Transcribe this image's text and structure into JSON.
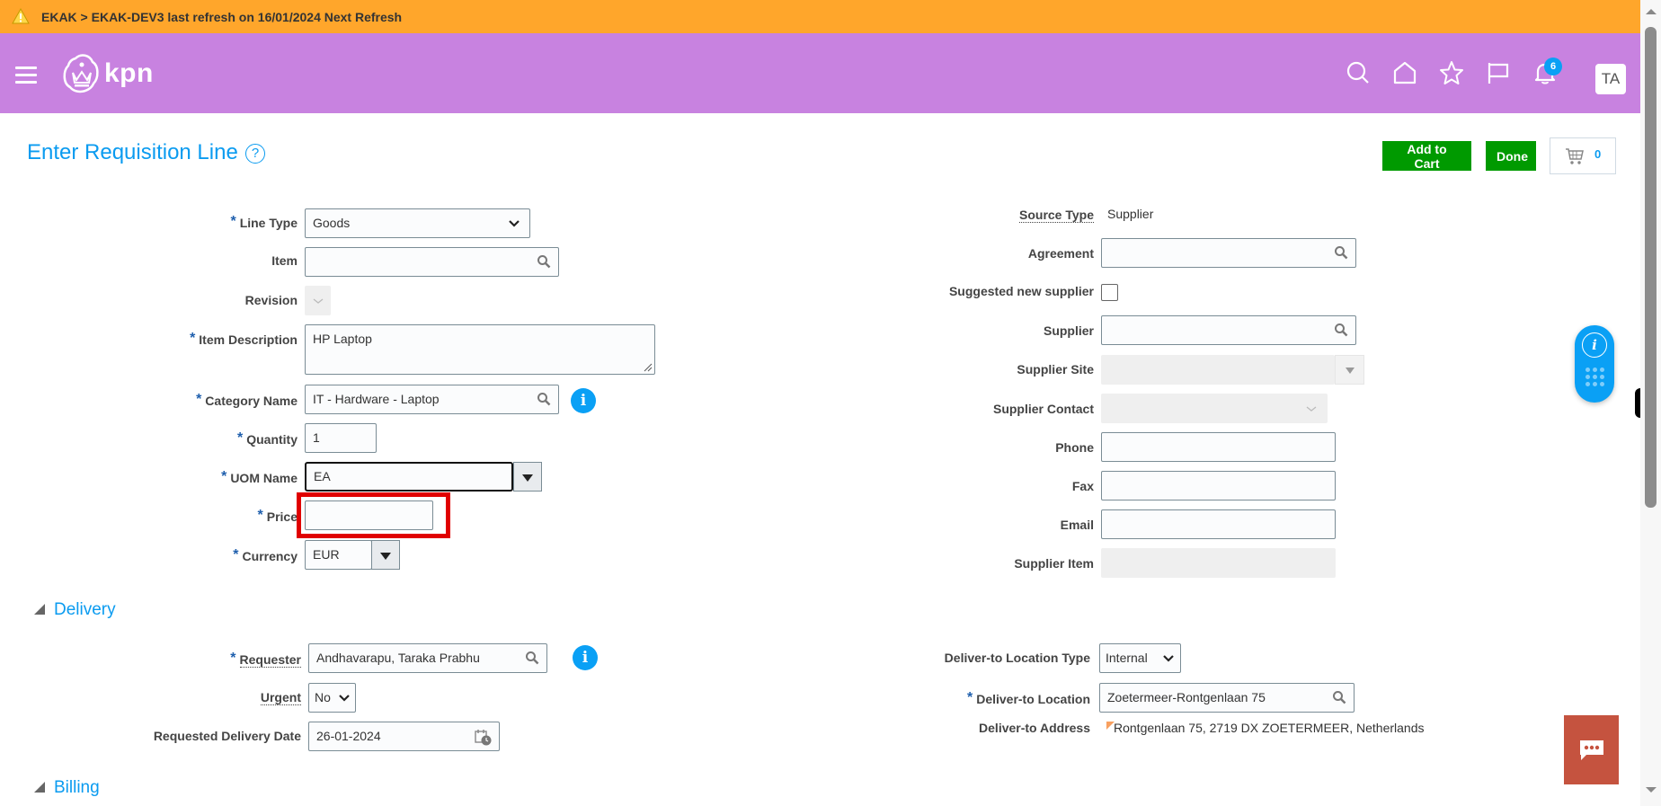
{
  "env_banner": {
    "text": "EKAK > EKAK-DEV3 last refresh on 16/01/2024 Next Refresh",
    "color": "#ffa62b"
  },
  "header": {
    "brand": "kpn",
    "color": "#c882e0",
    "notification_count": "6",
    "user_initials": "TA",
    "icons": [
      "menu-icon",
      "search-icon",
      "home-icon",
      "star-icon",
      "flag-icon",
      "bell-icon"
    ]
  },
  "page": {
    "title": "Enter Requisition Line",
    "add_to_cart_label": "Add to Cart",
    "done_label": "Done",
    "cart_count": "0"
  },
  "line_form": {
    "line_type": {
      "label": "Line Type",
      "required": true,
      "value": "Goods"
    },
    "item": {
      "label": "Item",
      "value": ""
    },
    "revision": {
      "label": "Revision",
      "value": ""
    },
    "item_description": {
      "label": "Item Description",
      "required": true,
      "value": "HP Laptop"
    },
    "category_name": {
      "label": "Category Name",
      "required": true,
      "value": "IT - Hardware - Laptop"
    },
    "quantity": {
      "label": "Quantity",
      "required": true,
      "value": "1"
    },
    "uom_name": {
      "label": "UOM Name",
      "required": true,
      "value": "EA"
    },
    "price": {
      "label": "Price",
      "required": true,
      "value": ""
    },
    "currency": {
      "label": "Currency",
      "required": true,
      "value": "EUR"
    }
  },
  "supplier_form": {
    "source_type": {
      "label": "Source Type",
      "value": "Supplier"
    },
    "agreement": {
      "label": "Agreement",
      "value": ""
    },
    "suggested_new_supplier": {
      "label": "Suggested new supplier",
      "checked": false
    },
    "supplier": {
      "label": "Supplier",
      "value": ""
    },
    "supplier_site": {
      "label": "Supplier Site",
      "value": ""
    },
    "supplier_contact": {
      "label": "Supplier Contact",
      "value": ""
    },
    "phone": {
      "label": "Phone",
      "value": ""
    },
    "fax": {
      "label": "Fax",
      "value": ""
    },
    "email": {
      "label": "Email",
      "value": ""
    },
    "supplier_item": {
      "label": "Supplier Item",
      "value": ""
    }
  },
  "delivery": {
    "section_label": "Delivery",
    "requester": {
      "label": "Requester",
      "required": true,
      "value": "Andhavarapu, Taraka Prabhu"
    },
    "urgent": {
      "label": "Urgent",
      "value": "No"
    },
    "requested_delivery_date": {
      "label": "Requested Delivery Date",
      "value": "26-01-2024"
    },
    "deliver_to_location_type": {
      "label": "Deliver-to Location Type",
      "value": "Internal"
    },
    "deliver_to_location": {
      "label": "Deliver-to Location",
      "required": true,
      "value": "Zoetermeer-Rontgenlaan 75"
    },
    "deliver_to_address": {
      "label": "Deliver-to Address",
      "value": "Rontgenlaan 75, 2719 DX ZOETERMEER, Netherlands"
    }
  },
  "billing": {
    "section_label": "Billing"
  },
  "colors": {
    "accent_blue": "#0a9bf0",
    "button_green": "#009a00",
    "highlight_red": "#e00000",
    "chat_button": "#c5533f"
  }
}
